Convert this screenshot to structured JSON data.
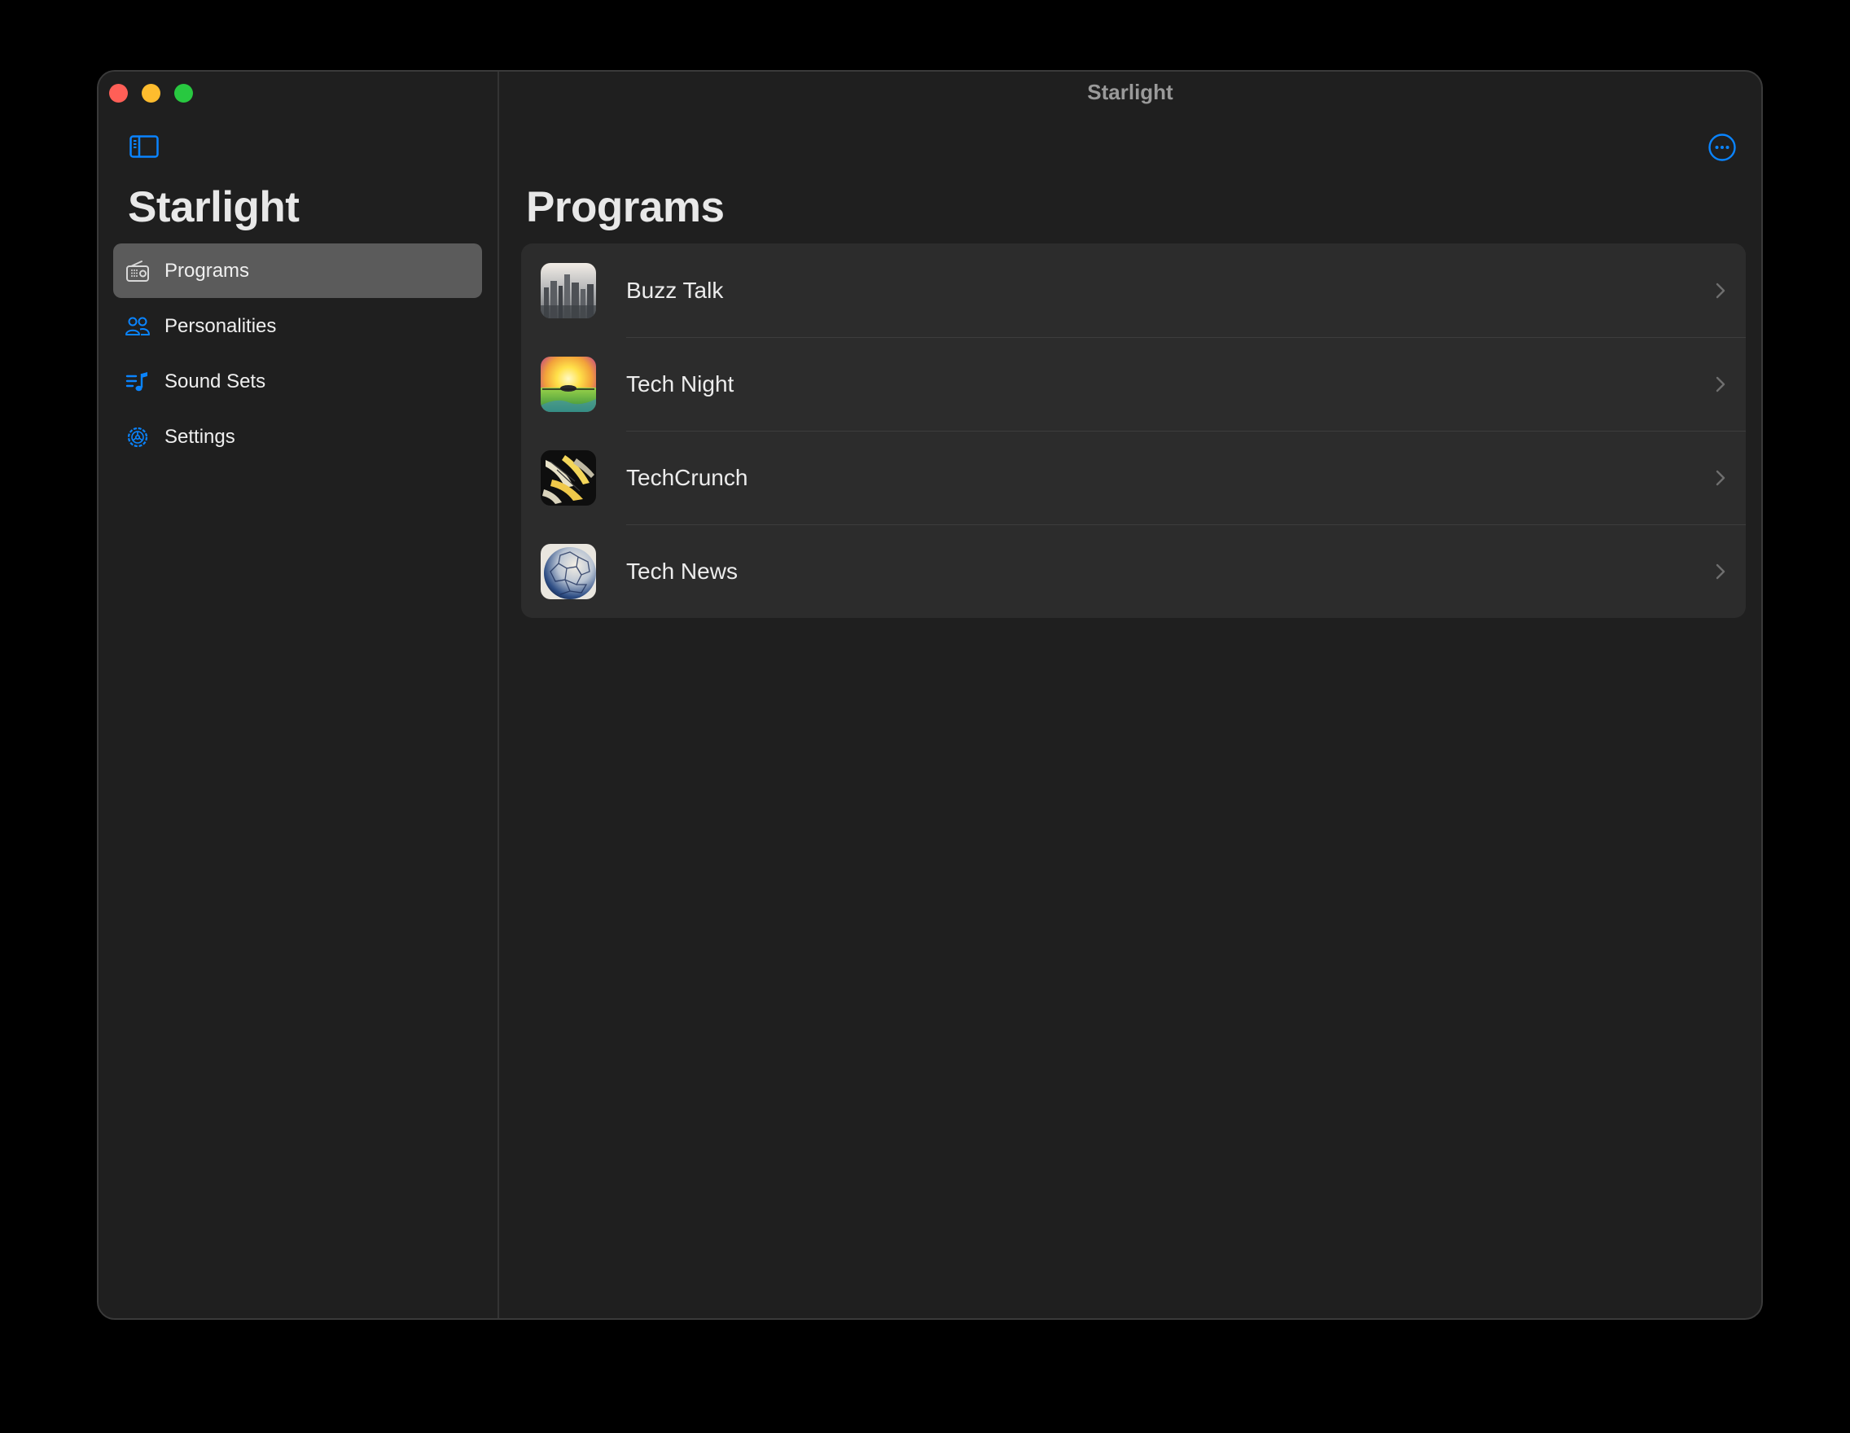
{
  "window": {
    "title": "Starlight"
  },
  "sidebar": {
    "title": "Starlight",
    "items": [
      {
        "label": "Programs",
        "icon": "radio-icon",
        "active": true
      },
      {
        "label": "Personalities",
        "icon": "people-icon",
        "active": false
      },
      {
        "label": "Sound Sets",
        "icon": "music-list-icon",
        "active": false
      },
      {
        "label": "Settings",
        "icon": "gear-icon",
        "active": false
      }
    ]
  },
  "main": {
    "title": "Programs",
    "programs": [
      {
        "label": "Buzz Talk",
        "thumbnail": "city-skyline-thumbnail"
      },
      {
        "label": "Tech Night",
        "thumbnail": "sunset-thumbnail"
      },
      {
        "label": "TechCrunch",
        "thumbnail": "abstract-claw-thumbnail"
      },
      {
        "label": "Tech News",
        "thumbnail": "globe-mesh-thumbnail"
      }
    ]
  },
  "colors": {
    "accent": "#0a84ff",
    "window_bg": "#1f1f1f",
    "list_bg": "#2c2c2c",
    "selected_bg": "#5b5b5b"
  }
}
